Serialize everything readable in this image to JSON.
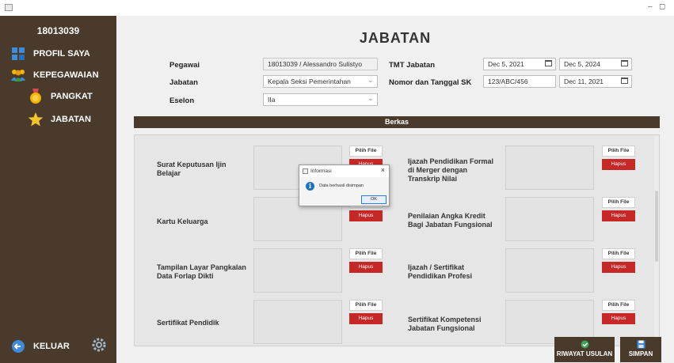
{
  "titlebar": {
    "minimize": "–",
    "maximize": "◻"
  },
  "sidebar": {
    "user_id": "18013039",
    "items": [
      {
        "label": "PROFIL SAYA",
        "icon": "profile-icon"
      },
      {
        "label": "KEPEGAWAIAN",
        "icon": "people-icon"
      },
      {
        "label": "PANGKAT",
        "icon": "medal-icon"
      },
      {
        "label": "JABATAN",
        "icon": "star-icon"
      }
    ],
    "logout_label": "KELUAR",
    "settings_icon": "gear-icon"
  },
  "page": {
    "title": "JABATAN"
  },
  "form": {
    "pegawai_label": "Pegawai",
    "pegawai_value": "18013039 / Alessandro Sulistyo",
    "jabatan_label": "Jabatan",
    "jabatan_value": "Kepala Seksi Pemerintahan",
    "eselon_label": "Eselon",
    "eselon_value": "IIa",
    "tmt_label": "TMT Jabatan",
    "tmt_start": "Dec 5, 2021",
    "tmt_end": "Dec 5, 2024",
    "sk_label": "Nomor dan Tanggal SK",
    "sk_number": "123/ABC/456",
    "sk_date": "Dec 11, 2021"
  },
  "berkas": {
    "title": "Berkas",
    "pilih_label": "Pilih File",
    "hapus_label": "Hapus",
    "docs_left": [
      "Surat Keputusan Ijin Belajar",
      "Kartu Keluarga",
      "Tampilan Layar Pangkalan Data Forlap Dikti",
      "Sertifikat Pendidik"
    ],
    "docs_right": [
      "Ijazah Pendidikan Formal di Merger dengan Transkrip Nilai",
      "Penilaian Angka Kredit Bagi Jabatan Fungsional",
      "Ijazah / Sertifikat Pendidikan Profesi",
      "Sertifikat Kompetensi Jabatan Fungsional"
    ]
  },
  "dialog": {
    "title": "Informasi",
    "message": "Data berhasil disimpan",
    "ok_label": "OK"
  },
  "actions": {
    "riwayat_label": "RIWAYAT USULAN",
    "simpan_label": "SIMPAN"
  },
  "colors": {
    "brown": "#4a3a2b",
    "red": "#c62828",
    "info_blue": "#1e73be"
  }
}
